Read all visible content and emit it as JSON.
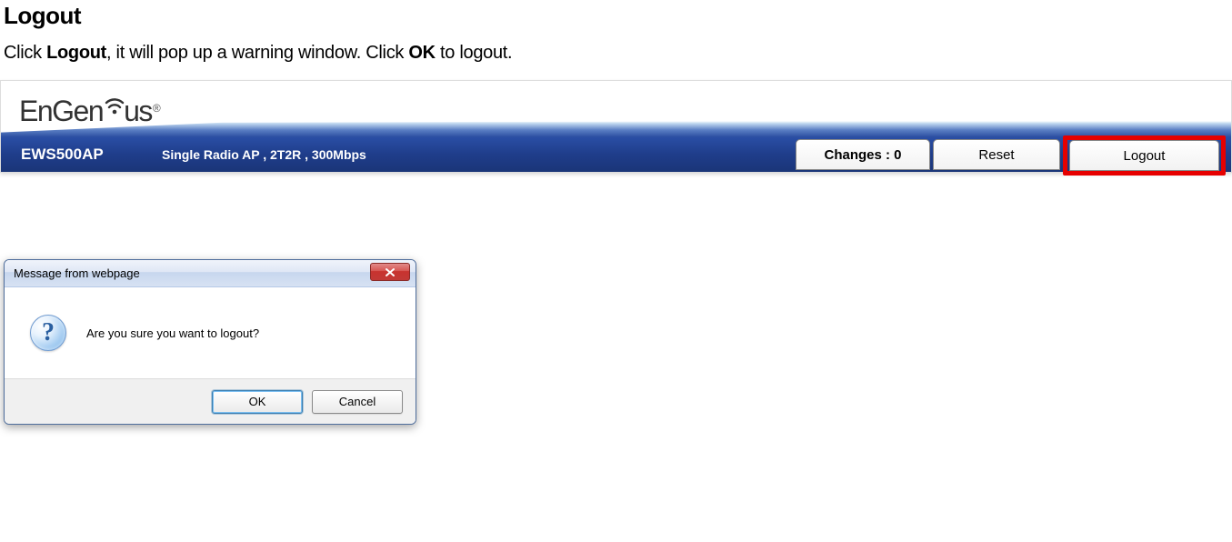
{
  "doc": {
    "heading": "Logout",
    "instruction_prefix": "Click ",
    "instruction_b1": "Logout",
    "instruction_mid": ", it will pop up a warning window. Click ",
    "instruction_b2": "OK",
    "instruction_suffix": " to logout."
  },
  "header": {
    "brand_en": "En",
    "brand_gen": "Gen",
    "brand_us": "us",
    "brand_reg": "®",
    "product": "EWS500AP",
    "description": "Single Radio AP , 2T2R , 300Mbps",
    "changes_label": "Changes : 0",
    "reset_label": "Reset",
    "logout_label": "Logout"
  },
  "dialog": {
    "title": "Message from webpage",
    "message": "Are you sure you want to logout?",
    "ok_label": "OK",
    "cancel_label": "Cancel"
  }
}
